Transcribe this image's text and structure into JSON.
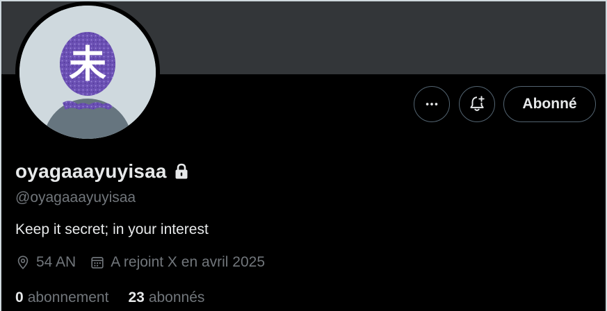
{
  "profile": {
    "display_name": "oyagaaayuyisaa",
    "handle": "@oyagaaayuyisaa",
    "protected_icon": "lock-icon",
    "bio": "Keep it secret; in your interest",
    "location": "54 AN",
    "joined": "A rejoint X en avril 2025",
    "avatar_glyph": "未"
  },
  "actions": {
    "more_icon": "more-horizontal-icon",
    "notifications_icon": "bell-plus-icon",
    "follow_label": "Abonné"
  },
  "stats": {
    "following_count": "0",
    "following_label": "abonnement",
    "followers_count": "23",
    "followers_label": "abonnés"
  },
  "colors": {
    "background": "#000000",
    "banner": "#333639",
    "text_primary": "#e7e9ea",
    "text_secondary": "#71767b",
    "border": "#536471"
  }
}
